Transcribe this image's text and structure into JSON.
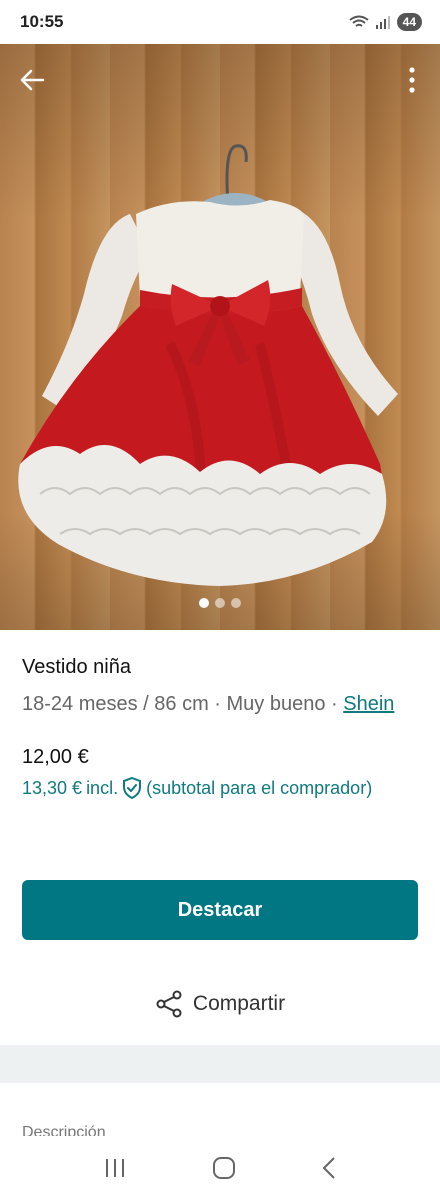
{
  "status_bar": {
    "time": "10:55",
    "battery": "44"
  },
  "photo": {
    "dot_count": 3,
    "active_dot": 0
  },
  "listing": {
    "title": "Vestido niña",
    "meta_prefix": "18-24 meses / 86 cm · Muy bueno · ",
    "brand": "Shein",
    "price": "12,00 €",
    "price_incl_amount": "13,30 €",
    "price_incl_label": "incl.",
    "price_incl_note": "(subtotal para el comprador)"
  },
  "actions": {
    "primary_label": "Destacar",
    "share_label": "Compartir"
  },
  "description": {
    "heading": "Descripción"
  },
  "colors": {
    "accent": "#007782",
    "link": "#0f7a80"
  }
}
